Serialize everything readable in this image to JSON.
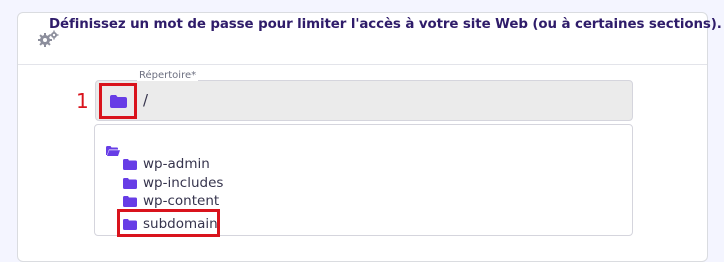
{
  "header": {
    "icon": "gears-icon",
    "title": "Définissez un mot de passe pour limiter l'accès à votre site Web (ou à certaines sections)."
  },
  "directory": {
    "label": "Répertoire*",
    "value": "/",
    "button_icon": "folder-icon"
  },
  "annotation": {
    "marker": "1",
    "color": "#d9131c"
  },
  "tree": {
    "root_icon": "folder-open-icon",
    "items": [
      {
        "label": "wp-admin",
        "icon": "folder-icon"
      },
      {
        "label": "wp-includes",
        "icon": "folder-icon"
      },
      {
        "label": "wp-content",
        "icon": "folder-icon"
      },
      {
        "label": "subdomain",
        "icon": "folder-icon",
        "highlighted": true
      }
    ]
  },
  "colors": {
    "accent": "#673de6",
    "title": "#2f1c6a",
    "highlight": "#d9131c"
  }
}
